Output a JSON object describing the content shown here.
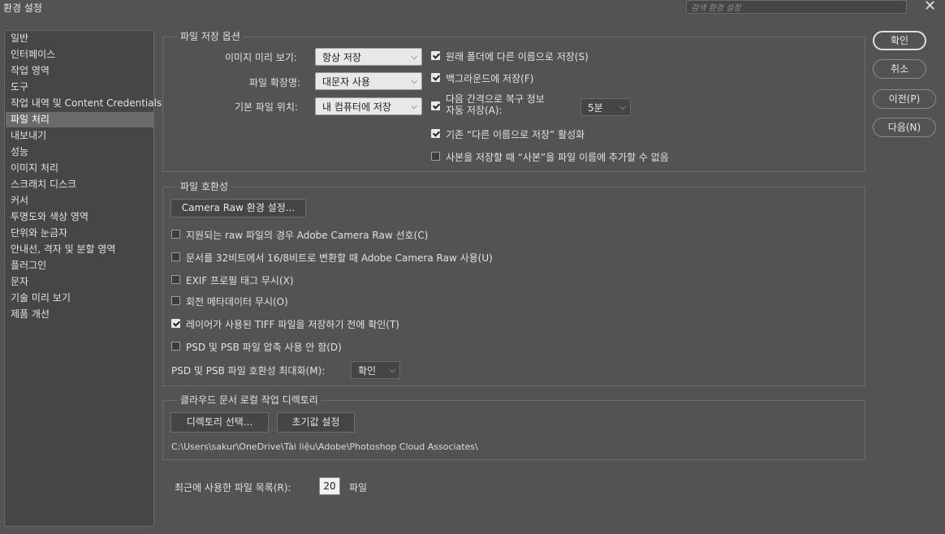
{
  "window": {
    "title": "환경 설정",
    "search_placeholder": "검색 환경 설정",
    "close_icon": "✕"
  },
  "sidebar": {
    "items": [
      {
        "label": "일반"
      },
      {
        "label": "인터페이스"
      },
      {
        "label": "작업 영역"
      },
      {
        "label": "도구"
      },
      {
        "label": "작업 내역 및 Content Credentials"
      },
      {
        "label": "파일 처리",
        "selected": true
      },
      {
        "label": "내보내기"
      },
      {
        "label": "성능"
      },
      {
        "label": "이미지 처리"
      },
      {
        "label": "스크래치 디스크"
      },
      {
        "label": "커서"
      },
      {
        "label": "투명도와 색상 영역"
      },
      {
        "label": "단위와 눈금자"
      },
      {
        "label": "안내선, 격자 및 분할 영역"
      },
      {
        "label": "플러그인"
      },
      {
        "label": "문자"
      },
      {
        "label": "기술 미리 보기"
      },
      {
        "label": "제품 개선"
      }
    ]
  },
  "file_save": {
    "legend": "파일 저장 옵션",
    "image_preview": {
      "label": "이미지 미리 보기:",
      "value": "항상 저장"
    },
    "file_extension": {
      "label": "파일 확장명:",
      "value": "대문자 사용"
    },
    "default_location": {
      "label": "기본 파일 위치:",
      "value": "내 컴퓨터에 저장"
    },
    "checks": {
      "save_as_original": {
        "label": "원래 폴더에 다른 이름으로 저장(S)",
        "checked": true
      },
      "background_save": {
        "label": "백그라운드에 저장(F)",
        "checked": true
      },
      "auto_save_line1": "다음 간격으로 복구 정보",
      "auto_save_line2": "자동 저장(A):",
      "auto_save_checked": true,
      "auto_save_interval": "5분",
      "legacy_save_as": {
        "label": "기존 “다른 이름으로 저장” 활성화",
        "checked": true
      },
      "no_copy_suffix": {
        "label": "사본을 저장할 때 “사본”을 파일 이름에 추가할 수 없음",
        "checked": false
      }
    }
  },
  "compat": {
    "legend": "파일 호환성",
    "camera_raw_button": "Camera Raw 환경 설정...",
    "checks": [
      {
        "label": "지원되는 raw 파일의 경우 Adobe Camera Raw 선호(C)",
        "checked": false
      },
      {
        "label": "문서를 32비트에서 16/8비트로 변환할 때 Adobe Camera Raw 사용(U)",
        "checked": false
      },
      {
        "label": "EXIF 프로필 태그 무시(X)",
        "checked": false
      },
      {
        "label": "회전 메타데이터 무시(O)",
        "checked": false
      },
      {
        "label": "레이어가 사용된 TIFF 파일을 저장하기 전에 확인(T)",
        "checked": true
      },
      {
        "label": "PSD 및 PSB 파일 압축 사용 안 함(D)",
        "checked": false
      }
    ],
    "maximize": {
      "label": "PSD 및 PSB 파일 호환성 최대화(M):",
      "value": "확인"
    }
  },
  "cloud": {
    "legend": "클라우드 문서 로컬 작업 디렉토리",
    "select_button": "디렉토리 선택...",
    "reset_button": "초기값 설정",
    "path": "C:\\Users\\sakur\\OneDrive\\Tài liệu\\Adobe\\Photoshop Cloud Associates\\"
  },
  "recent": {
    "label": "최근에 사용한 파일 목록(R):",
    "value": "20",
    "unit": "파일"
  },
  "buttons": {
    "ok": "확인",
    "cancel": "취소",
    "prev": "이전(P)",
    "next": "다음(N)"
  },
  "icons": {
    "dropdown": "chevron-down-icon",
    "close": "close-icon",
    "check": "checkmark-icon"
  }
}
